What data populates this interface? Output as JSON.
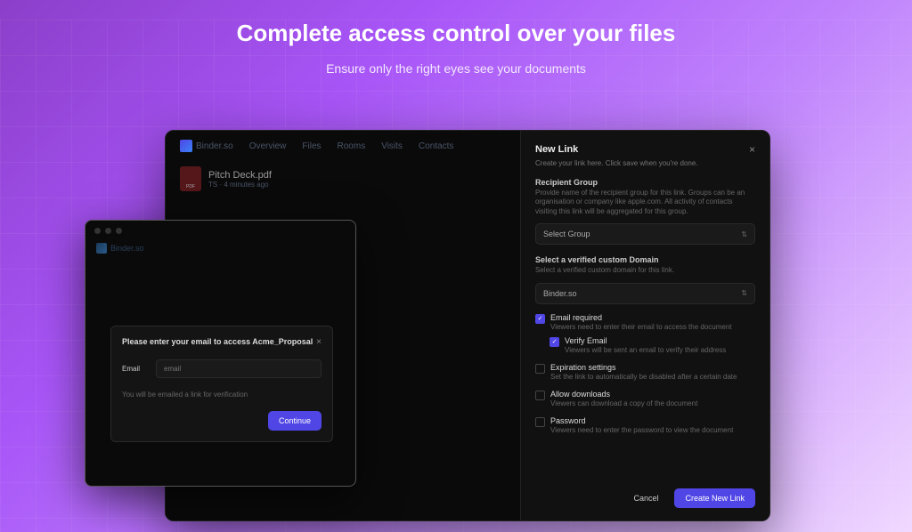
{
  "hero": {
    "title": "Complete access control over your files",
    "subtitle": "Ensure only the right eyes see your documents"
  },
  "app": {
    "brand": "Binder.so",
    "nav": [
      "Overview",
      "Files",
      "Rooms",
      "Visits",
      "Contacts"
    ],
    "file": {
      "name": "Pitch Deck.pdf",
      "meta": "TS · 4 minutes ago"
    }
  },
  "panel": {
    "title": "New Link",
    "subtitle": "Create your link here. Click save when you're done.",
    "recipient": {
      "label": "Recipient Group",
      "desc": "Provide name of the recipient group for this link. Groups can be an organisation or company like apple.com. All activity of contacts visiting this link will be aggregated for this group.",
      "value": "Select Group"
    },
    "domain": {
      "label": "Select a verified custom Domain",
      "desc": "Select a verified custom domain for this link.",
      "value": "Binder.so"
    },
    "options": {
      "email_required": {
        "label": "Email required",
        "desc": "Viewers need to enter their email to access the document",
        "checked": true
      },
      "verify_email": {
        "label": "Verify Email",
        "desc": "Viewers will be sent an email to verify their address",
        "checked": true
      },
      "expiration": {
        "label": "Expiration settings",
        "desc": "Set the link to automatically be disabled after a certain date",
        "checked": false
      },
      "downloads": {
        "label": "Allow downloads",
        "desc": "Viewers can download a copy of the document",
        "checked": false
      },
      "password": {
        "label": "Password",
        "desc": "Viewers need to enter the password to view the document",
        "checked": false
      }
    },
    "cancel": "Cancel",
    "submit": "Create New Link"
  },
  "modal": {
    "brand": "Binder.so",
    "title": "Please enter your email to access Acme_Proposal",
    "field_label": "Email",
    "placeholder": "email",
    "note": "You will be emailed a link for verification",
    "continue": "Continue"
  }
}
